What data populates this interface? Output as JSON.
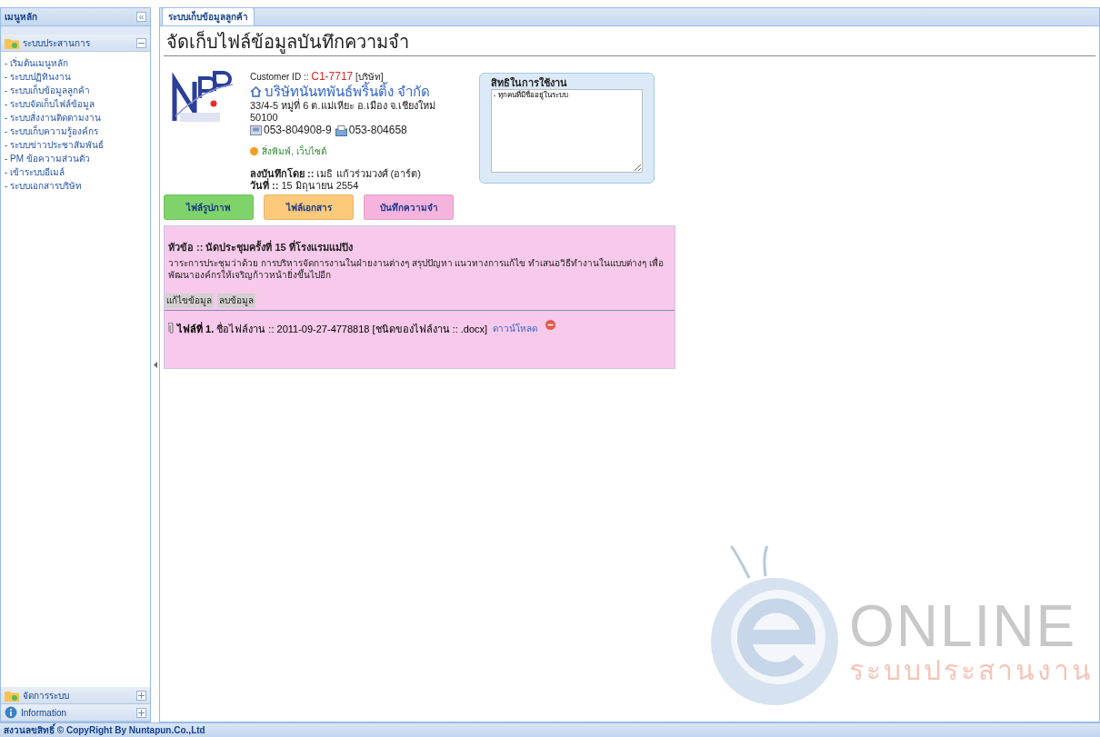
{
  "sidebar": {
    "title": "เมนูหลัก",
    "collapse": "«",
    "sections": [
      {
        "label": "ระบบประสานการ",
        "kind": "folder",
        "expanded": true,
        "items": [
          "- เริ่มต้นเมนูหลัก",
          "- ระบบปฏิทินงาน",
          "- ระบบเก็บข้อมูลลูกค้า",
          "- ระบบจัดเก็บไฟล์ข้อมูล",
          "- ระบบสั่งงานติดตามงาน",
          "- ระบบเก็บความรู้องค์กร",
          "- ระบบข่าวประชาสัมพันธ์",
          "- PM ข้อความส่วนตัว",
          "- เข้าระบบอีเมล์",
          "- ระบบเอกสารบริษัท"
        ]
      },
      {
        "label": "จัดการระบบ",
        "kind": "folder",
        "expanded": false
      },
      {
        "label": "Information",
        "kind": "info",
        "expanded": false
      }
    ]
  },
  "tabs": [
    {
      "label": "ระบบเก็บข้อมูลลูกค้า",
      "selected": true
    }
  ],
  "page_title": "จัดเก็บไฟล์ข้อมูลบันทึกความจำ",
  "customer": {
    "id_label": "Customer ID ::",
    "id": "C1-7717",
    "type": "[บริษัท]",
    "name": "บริษัทนันทพันธ์พริ้นติ้ง จำกัด",
    "address": "33/4-5 หมู่ที่ 6 ต.แม่เหียะ อ.เมือง จ.เชียงใหม่",
    "postcode": "50100",
    "phone": "053-804908-9",
    "fax": "053-804658",
    "business": "สิ่งพิมพ์, เว็บไซต์",
    "recorded_by": "**ลงบันทึกโดย ::** เมธิ แก้วร่วมวงศ์ (อาร์ต)",
    "date": "**วันที่ ::** 15 มิถุนายน 2554"
  },
  "rights": {
    "title": "สิทธิในการใช้งาน",
    "value": "- ทุกคนที่มีชื่ออยู่ในระบบ"
  },
  "category_buttons": [
    {
      "label": "ไฟล์รูปภาพ",
      "color": "#7ed36a"
    },
    {
      "label": "ไฟล์เอกสาร",
      "color": "#fdc97a"
    },
    {
      "label": "บันทึกความจำ",
      "color": "#f6b3dd"
    }
  ],
  "memo": {
    "subject": "หัวข้อ :: นัดประชุมครั้งที่ 15 ที่โรงแรมแม่ปิง",
    "body": "วาระการประชุมว่าด้วย การบริหารจัดการงานในฝ่ายงานต่างๆ สรุปปัญหา แนวทางการแก้ไข ทำเสนอวิธีทำงานในแบบต่างๆ เพื่อพัฒนาองค์กรให้เจริญก้าวหน้ายิ่งขึ้นไปอีก",
    "actions": [
      "แก้ไขข้อมูล",
      "ลบข้อมูล"
    ],
    "files": [
      {
        "text": "**ไฟล์ที่ 1.** ชื่อไฟล์งาน :: 2011-09-27-4778818 [ชนิดของไฟล์งาน :: .docx]",
        "link": "ดาวน์โหลด"
      }
    ]
  },
  "brand": {
    "logo": "ONLINE",
    "subtitle": "ระบบประสานงาน"
  },
  "footer": "สงวนลขสิทธิ์ © CopyRight By Nuntapun.Co.,Ltd"
}
